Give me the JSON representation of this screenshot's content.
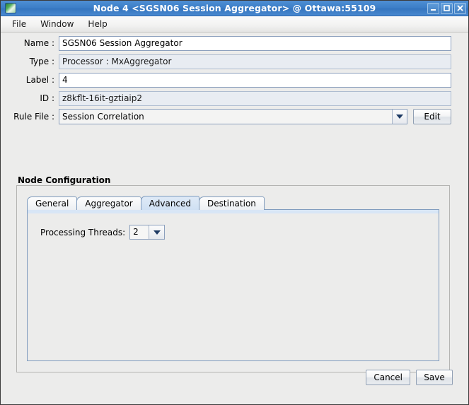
{
  "window": {
    "title": "Node 4 <SGSN06 Session Aggregator> @ Ottawa:55109",
    "app_icon": "node-app-icon",
    "controls": {
      "minimize": "minimize-icon",
      "maximize": "maximize-icon",
      "close": "close-icon"
    },
    "accent_color": "#3d7fc8",
    "body_color": "#ececeb"
  },
  "menubar": {
    "items": [
      {
        "label": "File"
      },
      {
        "label": "Window"
      },
      {
        "label": "Help"
      }
    ]
  },
  "form": {
    "fields": [
      {
        "label": "Name :",
        "value": "SGSN06 Session Aggregator",
        "editable": true
      },
      {
        "label": "Type :",
        "value": "Processor : MxAggregator",
        "editable": false
      },
      {
        "label": "Label :",
        "value": "4",
        "editable": true
      },
      {
        "label": "ID :",
        "value": "z8kflt-16it-gztiaip2",
        "editable": false
      }
    ],
    "rule_file": {
      "label": "Rule File :",
      "value": "Session Correlation",
      "dropdown_icon": "chevron-down-icon",
      "edit_button": "Edit"
    }
  },
  "group": {
    "title": "Node Configuration",
    "tabs": [
      {
        "label": "General",
        "active": false
      },
      {
        "label": "Aggregator",
        "active": false
      },
      {
        "label": "Advanced",
        "active": true
      },
      {
        "label": "Destination",
        "active": false
      }
    ],
    "advanced_panel": {
      "threads_label": "Processing Threads:",
      "threads_value": "2",
      "threads_dropdown_icon": "chevron-down-icon"
    }
  },
  "footer": {
    "cancel_label": "Cancel",
    "save_label": "Save"
  }
}
